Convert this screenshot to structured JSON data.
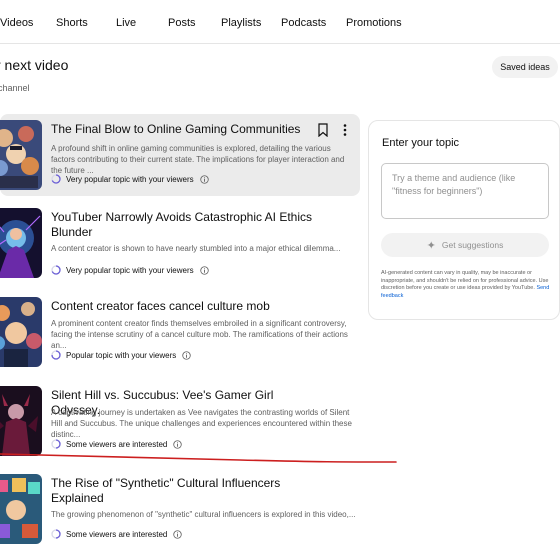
{
  "tabs": [
    "Videos",
    "Shorts",
    "Live",
    "Posts",
    "Playlists",
    "Podcasts",
    "Promotions"
  ],
  "header": {
    "title": "r next video",
    "subtitle": "channel",
    "saved_ideas_label": "Saved ideas"
  },
  "ideas": [
    {
      "title": "The Final Blow to Online Gaming Communities",
      "description": "A profound shift in online gaming communities is explored, detailing the various factors contributing to their current state. The implications for player interaction and the future ...",
      "status": "Very popular topic with your viewers",
      "popularity_level": 0.9,
      "highlighted": true
    },
    {
      "title": "YouTuber Narrowly Avoids Catastrophic AI Ethics Blunder",
      "description": "A content creator is shown to have nearly stumbled into a major ethical dilemma...",
      "status": "Very popular topic with your viewers",
      "popularity_level": 0.9,
      "highlighted": false
    },
    {
      "title": "Content creator faces cancel culture mob",
      "description": "A prominent content creator finds themselves embroiled in a significant controversy, facing the intense scrutiny of a cancel culture mob. The ramifications of their actions an...",
      "status": "Popular topic with your viewers",
      "popularity_level": 0.75,
      "highlighted": false
    },
    {
      "title": "Silent Hill vs. Succubus: Vee's Gamer Girl Odyssey.",
      "description": "A captivating journey is undertaken as Vee navigates the contrasting worlds of Silent Hill and Succubus. The unique challenges and experiences encountered within these distinc...",
      "status": "Some viewers are interested",
      "popularity_level": 0.5,
      "highlighted": false
    },
    {
      "title": "The Rise of \"Synthetic\" Cultural Influencers Explained",
      "description": "The growing phenomenon of \"synthetic\" cultural influencers is explored in this video,...",
      "status": "Some viewers are interested",
      "popularity_level": 0.5,
      "highlighted": false
    }
  ],
  "topic_panel": {
    "title": "Enter your topic",
    "input_placeholder": "Try a theme and audience (like \"fitness for beginners\")",
    "input_value": "",
    "suggest_button": "Get suggestions",
    "disclaimer": "AI-generated content can vary in quality, may be inaccurate or inappropriate, and shouldn't be relied on for professional advice. Use discretion before you create or use ideas provided by YouTube.",
    "feedback_link": "Send feedback"
  },
  "colors": {
    "highlight_bg": "#ebebeb",
    "status_ring": "#6b5fd6",
    "link": "#065fd4",
    "annotation_line": "#cc1f1f"
  },
  "icons": [
    "bookmark-icon",
    "more-vert-icon",
    "info-icon",
    "sparkle-icon",
    "popularity-ring-icon"
  ]
}
